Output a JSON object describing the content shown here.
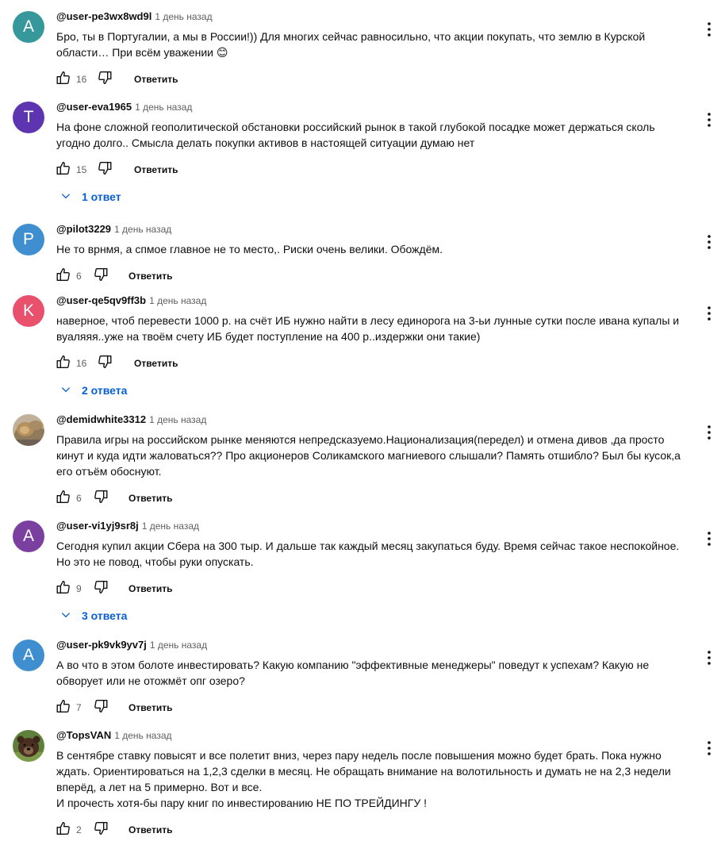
{
  "comments": [
    {
      "author": "@user-pe3wx8wd9l",
      "time": "1 день назад",
      "avatar": {
        "type": "letter",
        "letter": "A",
        "color": "#36989a"
      },
      "lines": [
        "Бро, ты в Португалии, а мы в России!)) Для многих сейчас равносильно, что акции покупать, что землю в Курской",
        "области… При всём уважении 😊"
      ],
      "likes": "16",
      "reply_label": "Ответить",
      "replies_label": ""
    },
    {
      "author": "@user-eva1965",
      "time": "1 день назад",
      "avatar": {
        "type": "letter",
        "letter": "T",
        "color": "#5e35b1"
      },
      "lines": [
        "На фоне сложной геополитической обстановки российский рынок в такой глубокой посадке может держаться сколь",
        "угодно долго.. Смысла делать покупки активов в настоящей ситуации думаю нет"
      ],
      "likes": "15",
      "reply_label": "Ответить",
      "replies_label": "1 ответ"
    },
    {
      "author": "@pilot3229",
      "time": "1 день назад",
      "avatar": {
        "type": "letter",
        "letter": "P",
        "color": "#3e8ed0"
      },
      "lines": [
        "Не то врнмя, а спмое главное не то место,. Риски очень велики. Обождём."
      ],
      "likes": "6",
      "reply_label": "Ответить",
      "replies_label": ""
    },
    {
      "author": "@user-qe5qv9ff3b",
      "time": "1 день назад",
      "avatar": {
        "type": "letter",
        "letter": "K",
        "color": "#e8506c"
      },
      "lines": [
        "наверное, чтоб перевести 1000 р. на счёт ИБ нужно найти в лесу единорога на 3-ьи лунные сутки после ивана купалы и",
        "вуаляяя..уже на твоём счету ИБ будет поступление на 400 р..издержки они такие)"
      ],
      "likes": "16",
      "reply_label": "Ответить",
      "replies_label": "2 ответа"
    },
    {
      "author": "@demidwhite3312",
      "time": "1 день назад",
      "avatar": {
        "type": "photo",
        "name": "lion-photo"
      },
      "lines": [
        "Правила игры на российском рынке меняются непредсказуемо.Национализация(передел) и отмена дивов ,да просто",
        "кинут и куда идти жаловаться?? Про акционеров Соликамского магниевого слышали? Память отшибло? Был бы кусок,а",
        "его отъём обоснуют."
      ],
      "likes": "6",
      "reply_label": "Ответить",
      "replies_label": ""
    },
    {
      "author": "@user-vi1yj9sr8j",
      "time": "1 день назад",
      "avatar": {
        "type": "letter",
        "letter": "A",
        "color": "#7b3fa0"
      },
      "lines": [
        "Сегодня купил акции Сбера на 300 тыр. И дальше так каждый месяц закупаться буду. Время сейчас такое неспокойное.",
        "Но это не повод, чтобы руки опускать."
      ],
      "likes": "9",
      "reply_label": "Ответить",
      "replies_label": "3 ответа"
    },
    {
      "author": "@user-pk9vk9yv7j",
      "time": "1 день назад",
      "avatar": {
        "type": "letter",
        "letter": "A",
        "color": "#3e8ed0"
      },
      "lines": [
        "А во что в этом болоте инвестировать? Какую компанию \"эффективные менеджеры\" поведут к успехам? Какую не",
        "обворует или не отожмёт опг озеро?"
      ],
      "likes": "7",
      "reply_label": "Ответить",
      "replies_label": ""
    },
    {
      "author": "@TopsVAN",
      "time": "1 день назад",
      "avatar": {
        "type": "photo",
        "name": "bear-photo"
      },
      "lines": [
        "В сентябре ставку повысят и все полетит вниз, через пару недель после повышения можно будет брать. Пока нужно",
        "ждать. Ориентироваться на 1,2,3 сделки в месяц. Не обращать внимание на волотильность и думать не на 2,3 недели",
        "вперёд, а лет на 5 примерно. Вот и все.",
        "И прочесть хотя-бы пару книг по инвестированию НЕ ПО ТРЕЙДИНГУ !"
      ],
      "likes": "2",
      "reply_label": "Ответить",
      "replies_label": ""
    }
  ]
}
